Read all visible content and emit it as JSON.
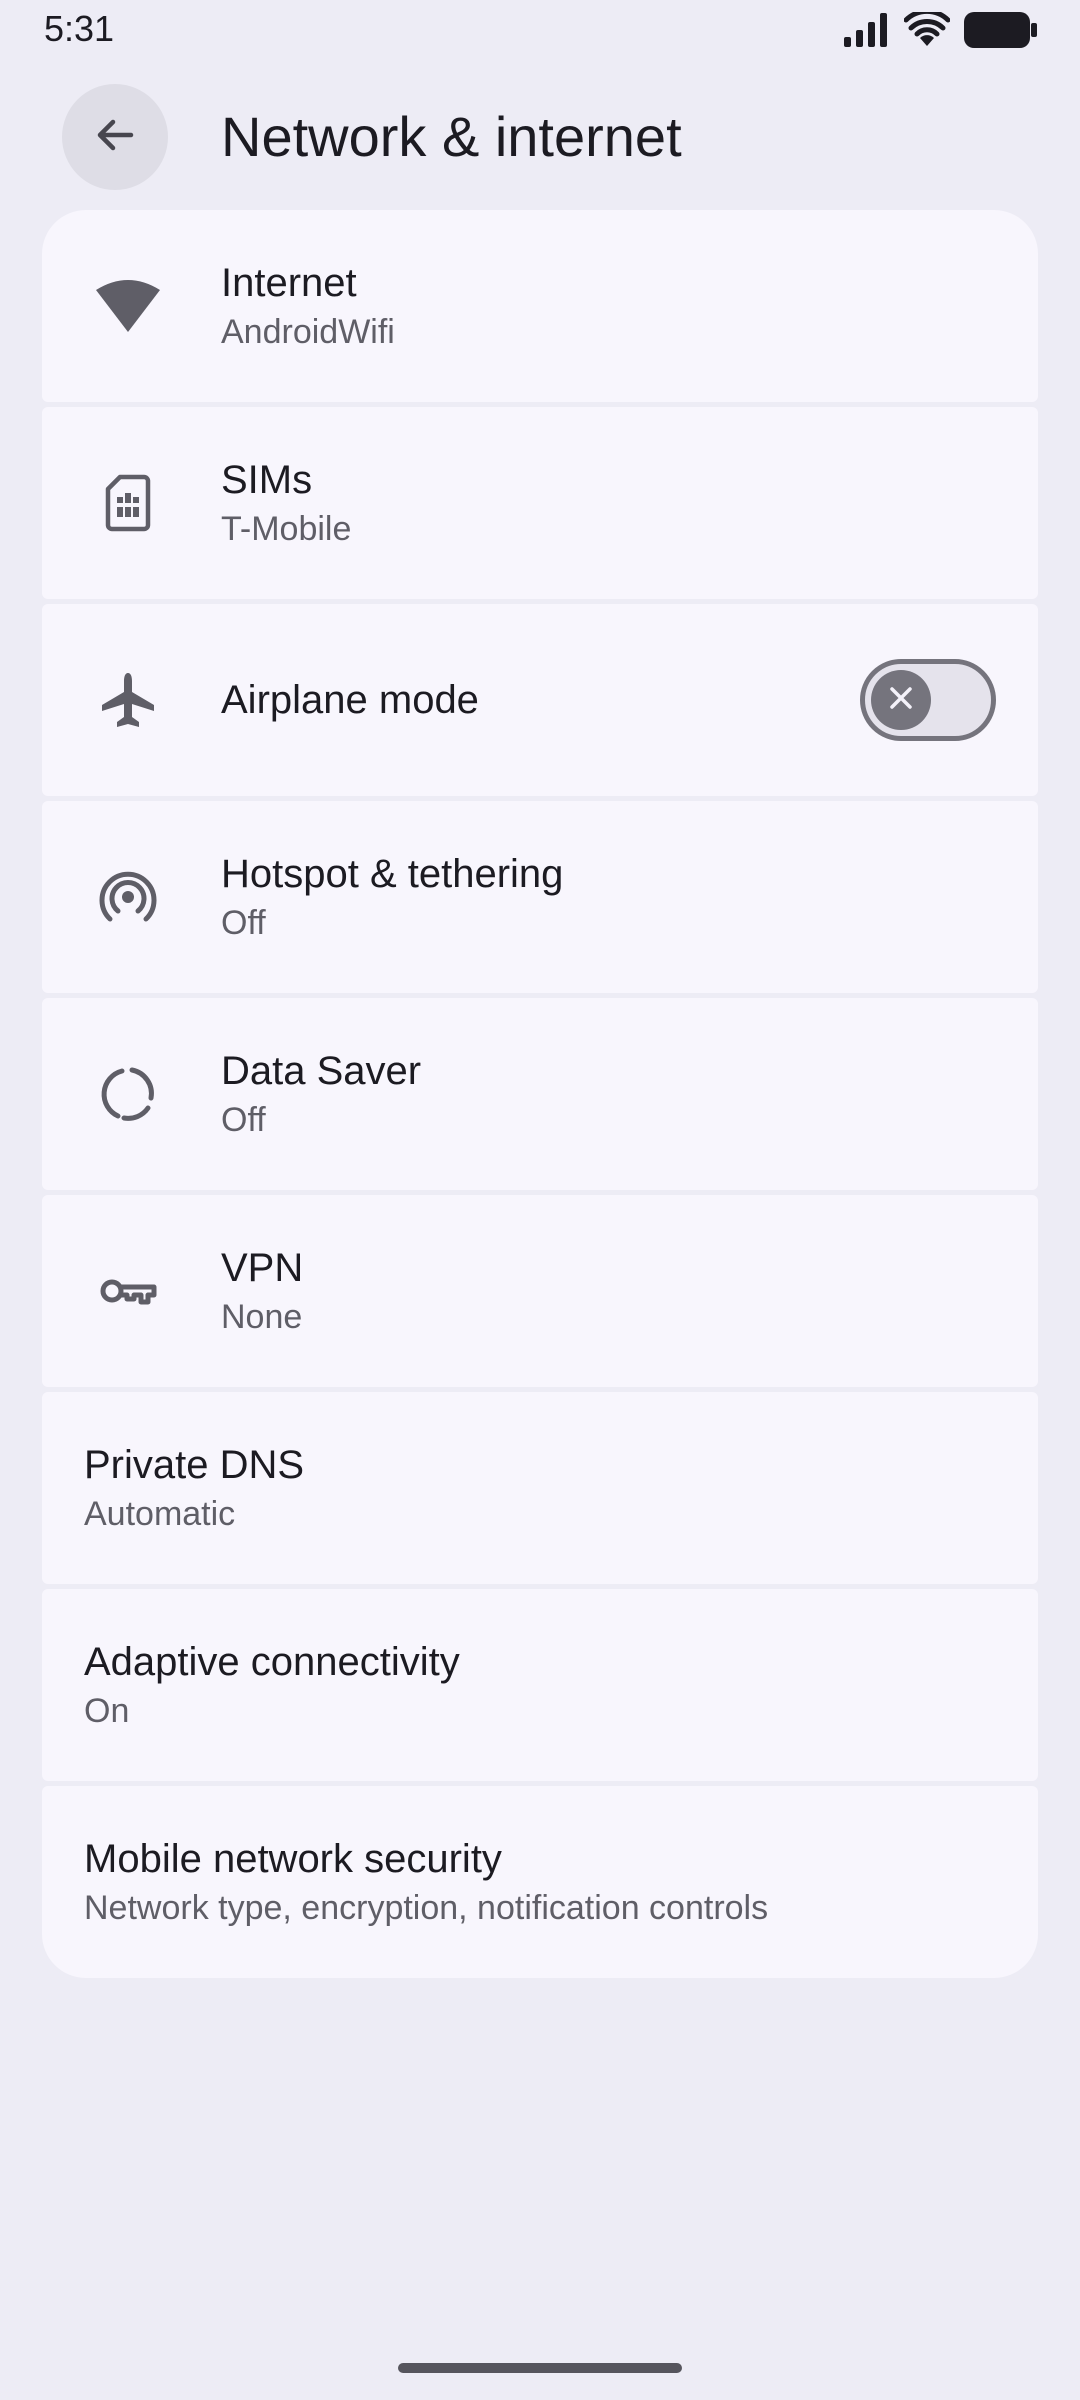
{
  "status_bar": {
    "time": "5:31"
  },
  "app_bar": {
    "title": "Network & internet",
    "back_icon": "arrow-back-icon"
  },
  "items": [
    {
      "id": "internet",
      "title": "Internet",
      "summary": "AndroidWifi",
      "icon": "wifi-icon"
    },
    {
      "id": "sims",
      "title": "SIMs",
      "summary": "T-Mobile",
      "icon": "sim-card-icon"
    },
    {
      "id": "airplane",
      "title": "Airplane mode",
      "icon": "airplane-icon",
      "toggle_on": false
    },
    {
      "id": "hotspot",
      "title": "Hotspot & tethering",
      "summary": "Off",
      "icon": "hotspot-icon"
    },
    {
      "id": "data-saver",
      "title": "Data Saver",
      "summary": "Off",
      "icon": "data-saver-icon"
    },
    {
      "id": "vpn",
      "title": "VPN",
      "summary": "None",
      "icon": "key-icon"
    },
    {
      "id": "private-dns",
      "title": "Private DNS",
      "summary": "Automatic"
    },
    {
      "id": "adaptive",
      "title": "Adaptive connectivity",
      "summary": "On"
    },
    {
      "id": "mobile-security",
      "title": "Mobile network security",
      "summary": "Network type, encryption, notification controls"
    }
  ],
  "colors": {
    "background": "#edecf5",
    "card": "#f8f6fd",
    "icon": "#5f5e67",
    "text_primary": "#1c1b22",
    "text_secondary": "#5f5e67"
  }
}
